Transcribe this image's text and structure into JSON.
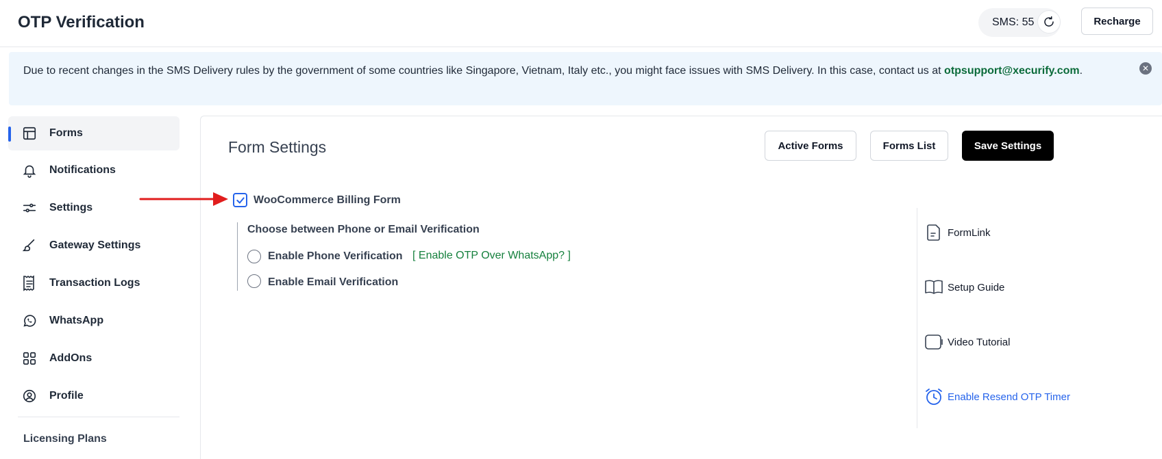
{
  "header": {
    "title": "OTP Verification",
    "sms_label": "SMS: 55",
    "recharge_label": "Recharge"
  },
  "notice": {
    "text": "Due to recent changes in the SMS Delivery rules by the government of some countries like Singapore, Vietnam, Italy etc., you might face issues with SMS Delivery. In this case, contact us at ",
    "email": "otpsupport@xecurify.com",
    "suffix": "."
  },
  "sidebar": {
    "items": [
      {
        "label": "Forms",
        "icon": "layout-icon",
        "active": true
      },
      {
        "label": "Notifications",
        "icon": "bell-icon"
      },
      {
        "label": "Settings",
        "icon": "sliders-icon"
      },
      {
        "label": "Gateway Settings",
        "icon": "brush-icon"
      },
      {
        "label": "Transaction Logs",
        "icon": "receipt-icon"
      },
      {
        "label": "WhatsApp",
        "icon": "whatsapp-icon"
      },
      {
        "label": "AddOns",
        "icon": "grid-icon"
      },
      {
        "label": "Profile",
        "icon": "user-circle-icon"
      }
    ],
    "licensing": "Licensing Plans"
  },
  "main": {
    "title": "Form Settings",
    "buttons": {
      "active_forms": "Active Forms",
      "forms_list": "Forms List",
      "save_settings": "Save Settings"
    },
    "form": {
      "name": "WooCommerce Billing Form",
      "checked": true,
      "choose_label": "Choose between Phone or Email Verification",
      "options": [
        {
          "label": "Enable Phone Verification",
          "selected": false
        },
        {
          "label": "Enable Email Verification",
          "selected": false
        }
      ],
      "whatsapp_link": "[ Enable OTP Over WhatsApp? ]"
    },
    "right_links": [
      {
        "label": "FormLink",
        "icon": "document-icon"
      },
      {
        "label": "Setup Guide",
        "icon": "book-icon"
      },
      {
        "label": "Video Tutorial",
        "icon": "video-icon"
      },
      {
        "label": "Enable Resend OTP Timer",
        "icon": "alarm-clock-icon"
      }
    ]
  },
  "colors": {
    "accent": "#2563eb",
    "notice_bg": "#eef6fd",
    "link_green": "#15803d",
    "arrow_red": "#e11d1d"
  }
}
